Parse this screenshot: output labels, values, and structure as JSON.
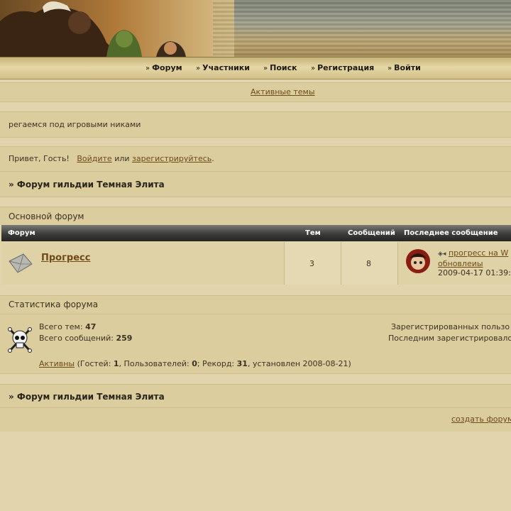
{
  "nav": [
    {
      "label": "Форум"
    },
    {
      "label": "Участники"
    },
    {
      "label": "Поиск"
    },
    {
      "label": "Регистрация"
    },
    {
      "label": "Войти"
    }
  ],
  "active_topics_link": "Активные темы",
  "announcement": "регаемся под игровыми никами",
  "greeting": {
    "prefix": "Привет, Гость!",
    "login": "Войдите",
    "or": "или",
    "register": "зарегистрируйтесь",
    "end": "."
  },
  "breadcrumb": "» Форум гильдии Темная Элита",
  "category": "Основной форум",
  "table": {
    "headers": {
      "forum": "Форум",
      "topics": "Тем",
      "posts": "Сообщений",
      "last": "Последнее сообщение"
    },
    "rows": [
      {
        "name": "Прогресс",
        "topics": "3",
        "posts": "8",
        "last_title": "прогресс на W",
        "last_line2": "обновлеиы",
        "last_date": "2009-04-17 01:39:"
      }
    ]
  },
  "stats": {
    "title": "Статистика форума",
    "total_topics_label": "Всего тем:",
    "total_topics": "47",
    "total_posts_label": "Всего сообщений:",
    "total_posts": "259",
    "registered_text": "Зарегистрированных пользо",
    "last_registered_text": "Последним зарегистрировало",
    "active_link": "Активны",
    "active_guests_label": "(Гостей:",
    "guests": "1",
    "users_label": ", Пользователей:",
    "users": "0",
    "record_label": "; Рекорд:",
    "record": "31",
    "record_date": ", установлен 2008-08-21)"
  },
  "bottom_breadcrumb": "» Форум гильдии Темная Элита",
  "create_forum_link": "создать форум"
}
